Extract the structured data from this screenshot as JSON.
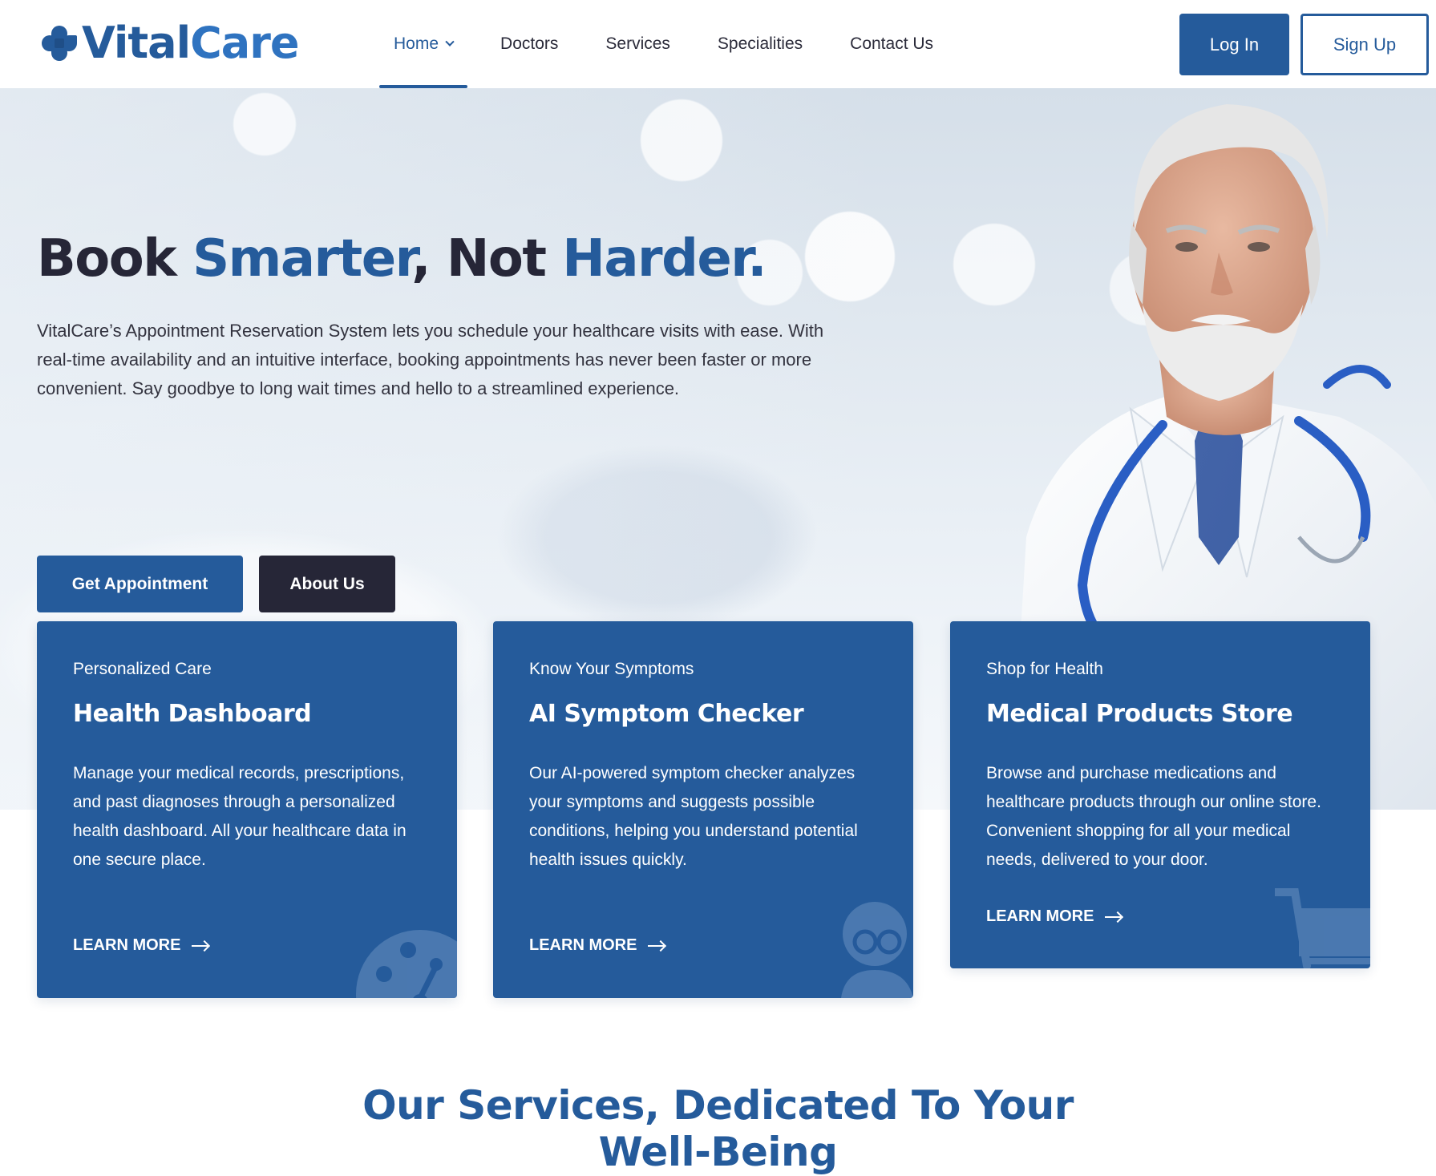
{
  "brand": {
    "name_part1": "Vital",
    "name_part2": "Care",
    "logo_icon": "clover-logo-icon",
    "primary_color": "#255b9b",
    "dark_color": "#262637"
  },
  "nav": {
    "items": [
      {
        "label": "Home",
        "active": true,
        "has_dropdown": true
      },
      {
        "label": "Doctors"
      },
      {
        "label": "Services"
      },
      {
        "label": "Specialities"
      },
      {
        "label": "Contact Us"
      }
    ],
    "login_label": "Log In",
    "signup_label": "Sign Up"
  },
  "hero": {
    "title_part1": "Book ",
    "title_part2": "Smarter",
    "title_part3": ", Not ",
    "title_part4": "Harder.",
    "description": "VitalCare’s Appointment Reservation System lets you schedule your healthcare visits with ease. With real-time availability and an intuitive interface, booking appointments has never been faster or more convenient. Say goodbye to long wait times and hello to a streamlined experience.",
    "primary_button": "Get Appointment",
    "secondary_button": "About Us"
  },
  "cards": [
    {
      "kicker": "Personalized Care",
      "title": "Health Dashboard",
      "description": "Manage your medical records, prescriptions, and past diagnoses through a personalized health dashboard. All your healthcare data in one secure place.",
      "link": "LEARN MORE",
      "icon": "dashboard-gauge-icon"
    },
    {
      "kicker": "Know Your Symptoms",
      "title": "AI Symptom Checker",
      "description": "Our AI-powered symptom checker analyzes your symptoms and suggests possible conditions, helping you understand potential health issues quickly.",
      "link": "LEARN MORE",
      "icon": "doctor-avatar-icon"
    },
    {
      "kicker": "Shop for Health",
      "title": "Medical Products Store",
      "description": "Browse and purchase medications and healthcare products through our online store. Convenient shopping for all your medical needs, delivered to your door.",
      "link": "LEARN MORE",
      "icon": "shopping-cart-icon"
    }
  ],
  "services_section": {
    "title_line1": "Our Services, Dedicated To Your",
    "title_line2": "Well-Being"
  }
}
